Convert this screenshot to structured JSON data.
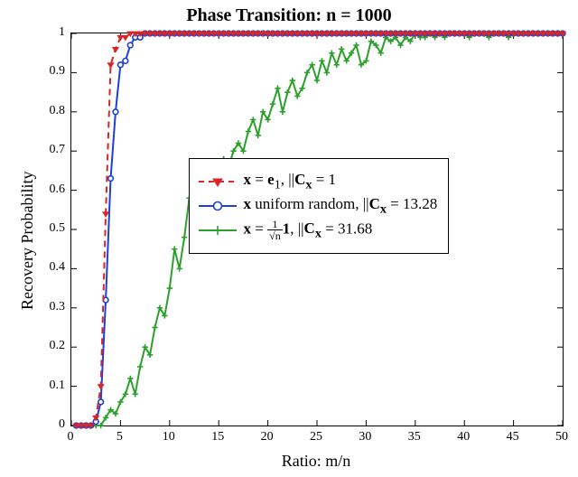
{
  "chart_data": {
    "type": "line",
    "title": "Phase Transition: n = 1000",
    "xlabel": "Ratio: m/n",
    "ylabel": "Recovery Probability",
    "xlim": [
      0,
      50
    ],
    "ylim": [
      0,
      1
    ],
    "xticks": [
      0,
      5,
      10,
      15,
      20,
      25,
      30,
      35,
      40,
      45,
      50
    ],
    "yticks": [
      0,
      0.1,
      0.2,
      0.3,
      0.4,
      0.5,
      0.6,
      0.7,
      0.8,
      0.9,
      1
    ],
    "grid": false,
    "legend_position": "center-right",
    "x": [
      0.5,
      1,
      1.5,
      2,
      2.5,
      3,
      3.5,
      4,
      4.5,
      5,
      5.5,
      6,
      6.5,
      7,
      7.5,
      8,
      8.5,
      9,
      9.5,
      10,
      10.5,
      11,
      11.5,
      12,
      12.5,
      13,
      13.5,
      14,
      14.5,
      15,
      15.5,
      16,
      16.5,
      17,
      17.5,
      18,
      18.5,
      19,
      19.5,
      20,
      20.5,
      21,
      21.5,
      22,
      22.5,
      23,
      23.5,
      24,
      24.5,
      25,
      25.5,
      26,
      26.5,
      27,
      27.5,
      28,
      28.5,
      29,
      29.5,
      30,
      30.5,
      31,
      31.5,
      32,
      32.5,
      33,
      33.5,
      34,
      34.5,
      35,
      35.5,
      36,
      36.5,
      37,
      37.5,
      38,
      38.5,
      39,
      39.5,
      40,
      40.5,
      41,
      41.5,
      42,
      42.5,
      43,
      43.5,
      44,
      44.5,
      45,
      45.5,
      46,
      46.5,
      47,
      47.5,
      48,
      48.5,
      49,
      49.5,
      50
    ],
    "series": [
      {
        "name": "x = e1, ||Cx|| = 1",
        "label_parts": {
          "prefix": "x = e",
          "sub": "1",
          "mid": ", ||C",
          "subx": "x",
          "tail": "|| = 1"
        },
        "color": "#d62728",
        "marker": "triangle-down",
        "linestyle": "dash",
        "values": [
          0,
          0,
          0,
          0,
          0.02,
          0.1,
          0.54,
          0.92,
          0.96,
          0.99,
          0.99,
          1,
          1,
          1,
          1,
          1,
          1,
          1,
          1,
          1,
          1,
          1,
          1,
          1,
          1,
          1,
          1,
          1,
          1,
          1,
          1,
          1,
          1,
          1,
          1,
          1,
          1,
          1,
          1,
          1,
          1,
          1,
          1,
          1,
          1,
          1,
          1,
          1,
          1,
          1,
          1,
          1,
          1,
          1,
          1,
          1,
          1,
          1,
          1,
          1,
          1,
          1,
          1,
          1,
          1,
          1,
          1,
          1,
          1,
          1,
          1,
          1,
          1,
          1,
          1,
          1,
          1,
          1,
          1,
          1,
          1,
          1,
          1,
          1,
          1,
          1,
          1,
          1,
          1,
          1,
          1,
          1,
          1,
          1,
          1,
          1,
          1,
          1,
          1,
          1
        ]
      },
      {
        "name": "x uniform random, ||Cx|| = 13.28",
        "label_parts": {
          "prefix": "x uniform random, ||C",
          "subx": "x",
          "tail": "|| = 13.28"
        },
        "color": "#1f3fd4",
        "marker": "circle",
        "linestyle": "solid",
        "values": [
          0,
          0,
          0,
          0,
          0.01,
          0.06,
          0.32,
          0.63,
          0.8,
          0.92,
          0.93,
          0.97,
          0.99,
          0.99,
          1,
          1,
          1,
          1,
          1,
          1,
          1,
          1,
          1,
          1,
          1,
          1,
          1,
          1,
          1,
          1,
          1,
          1,
          1,
          1,
          1,
          1,
          1,
          1,
          1,
          1,
          1,
          1,
          1,
          1,
          1,
          1,
          1,
          1,
          1,
          1,
          1,
          1,
          1,
          1,
          1,
          1,
          1,
          1,
          1,
          1,
          1,
          1,
          1,
          1,
          1,
          1,
          1,
          1,
          1,
          1,
          1,
          1,
          1,
          1,
          1,
          1,
          1,
          1,
          1,
          1,
          1,
          1,
          1,
          1,
          1,
          1,
          1,
          1,
          1,
          1,
          1,
          1,
          1,
          1,
          1,
          1,
          1,
          1,
          1,
          1
        ]
      },
      {
        "name": "x = (1/sqrt(n)) 1, ||Cx|| = 31.68",
        "label_parts": {
          "prefix": "x = ",
          "frac_num": "1",
          "frac_den": "√n",
          "mid": " 1, ||C",
          "subx": "x",
          "tail": "|| = 31.68"
        },
        "color": "#2ca02c",
        "marker": "plus",
        "linestyle": "solid",
        "values": [
          0,
          0,
          0,
          0,
          0,
          0,
          0.02,
          0.04,
          0.03,
          0.06,
          0.08,
          0.12,
          0.08,
          0.15,
          0.2,
          0.18,
          0.25,
          0.3,
          0.28,
          0.35,
          0.45,
          0.4,
          0.48,
          0.58,
          0.53,
          0.6,
          0.65,
          0.6,
          0.66,
          0.63,
          0.68,
          0.66,
          0.7,
          0.72,
          0.7,
          0.75,
          0.78,
          0.74,
          0.8,
          0.78,
          0.82,
          0.86,
          0.8,
          0.85,
          0.88,
          0.84,
          0.86,
          0.9,
          0.92,
          0.88,
          0.93,
          0.9,
          0.95,
          0.92,
          0.96,
          0.93,
          0.95,
          0.97,
          0.92,
          0.93,
          0.98,
          0.97,
          0.95,
          0.99,
          0.98,
          0.99,
          0.97,
          0.99,
          0.98,
          1,
          0.99,
          0.99,
          1,
          0.99,
          1,
          0.99,
          1,
          1,
          1,
          1,
          0.99,
          1,
          1,
          1,
          0.99,
          1,
          1,
          1,
          0.99,
          1,
          1,
          1,
          1,
          1,
          1,
          1,
          1,
          1,
          1,
          1
        ]
      }
    ]
  }
}
